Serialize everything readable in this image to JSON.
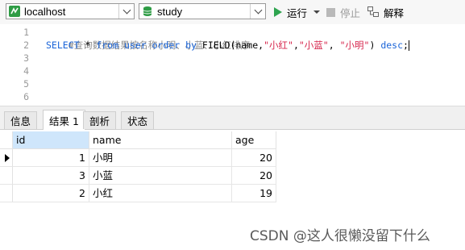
{
  "toolbar": {
    "connection": "localhost",
    "database": "study",
    "run_label": "运行",
    "stop_label": "停止",
    "explain_label": "解释"
  },
  "editor": {
    "line_numbers": [
      "1",
      "2",
      "3",
      "4",
      "5",
      "6"
    ],
    "line1_comment": "#查询数据结果按名称小明、小蓝、小红排序",
    "line2": {
      "select": "SELECT",
      "star": " * ",
      "from": "from",
      "table": " user ",
      "order_by": "order by",
      "fn": " FIELD(",
      "col": "name",
      "s1": "\"小红\"",
      "s2": "\"小蓝\"",
      "s3": "\"小明\"",
      "close": ") ",
      "desc": "desc",
      "end": ";"
    }
  },
  "tabs": [
    "信息",
    "结果 1",
    "剖析",
    "状态"
  ],
  "result": {
    "columns": [
      "id",
      "name",
      "age"
    ],
    "rows": [
      {
        "id": "1",
        "name": "小明",
        "age": "20"
      },
      {
        "id": "3",
        "name": "小蓝",
        "age": "20"
      },
      {
        "id": "2",
        "name": "小红",
        "age": "19"
      }
    ]
  },
  "watermark": "CSDN @这人很懒没留下什么",
  "colors": {
    "run_green": "#2ea44f",
    "keyword_blue": "#1a64d8",
    "string_red": "#d6244b"
  }
}
